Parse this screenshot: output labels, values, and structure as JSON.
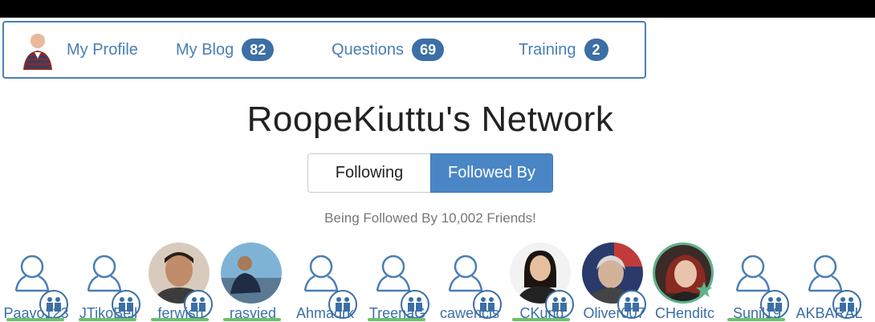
{
  "nav": {
    "profile": "My Profile",
    "blog": {
      "label": "My Blog",
      "count": "82"
    },
    "questions": {
      "label": "Questions",
      "count": "69"
    },
    "training": {
      "label": "Training",
      "count": "2"
    }
  },
  "page_title": "RoopeKiuttu's Network",
  "toggle": {
    "following": "Following",
    "followed_by": "Followed By",
    "active": "followed_by"
  },
  "subtitle": "Being Followed By 10,002 Friends!",
  "friends": [
    {
      "name": "Paavo123",
      "avatar": "default-user-icon"
    },
    {
      "name": "JTikoBell",
      "avatar": "default-user-icon"
    },
    {
      "name": "ferwish",
      "avatar": "photo"
    },
    {
      "name": "rasyied",
      "avatar": "photo"
    },
    {
      "name": "Ahmadrk",
      "avatar": "default-user-icon"
    },
    {
      "name": "TreenaG",
      "avatar": "default-user-icon"
    },
    {
      "name": "cawencis",
      "avatar": "default-user-icon"
    },
    {
      "name": "CKung",
      "avatar": "photo"
    },
    {
      "name": "Oliver007",
      "avatar": "photo"
    },
    {
      "name": "CHenditc",
      "avatar": "photo-featured"
    },
    {
      "name": "Sunil19",
      "avatar": "default-user-icon"
    },
    {
      "name": "AKBARAL",
      "avatar": "default-user-icon"
    }
  ],
  "colors": {
    "accent": "#4a7fb5",
    "badge": "#3b6fa5",
    "active_toggle": "#4a86c5",
    "featured_ring": "#5cb38a"
  }
}
